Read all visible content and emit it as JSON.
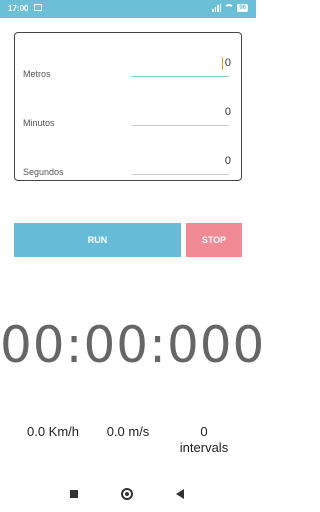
{
  "statusbar": {
    "time": "17:00",
    "battery": "96",
    "accent": "#6bbfd6"
  },
  "form": {
    "fields": [
      {
        "label": "Metros",
        "value": "0"
      },
      {
        "label": "Minutos",
        "value": "0"
      },
      {
        "label": "Segundos",
        "value": "0"
      }
    ]
  },
  "buttons": {
    "run": "RUN",
    "stop": "STOP",
    "run_color": "#66bcd7",
    "stop_color": "#f08a94"
  },
  "timer": {
    "display": "00:00:000"
  },
  "stats": {
    "speed_kmh": "0.0 Km/h",
    "speed_ms": "0.0 m/s",
    "intervals_count": "0",
    "intervals_label": "intervals"
  },
  "navbar": {
    "icons": [
      "recents-icon",
      "home-icon",
      "back-icon"
    ]
  }
}
